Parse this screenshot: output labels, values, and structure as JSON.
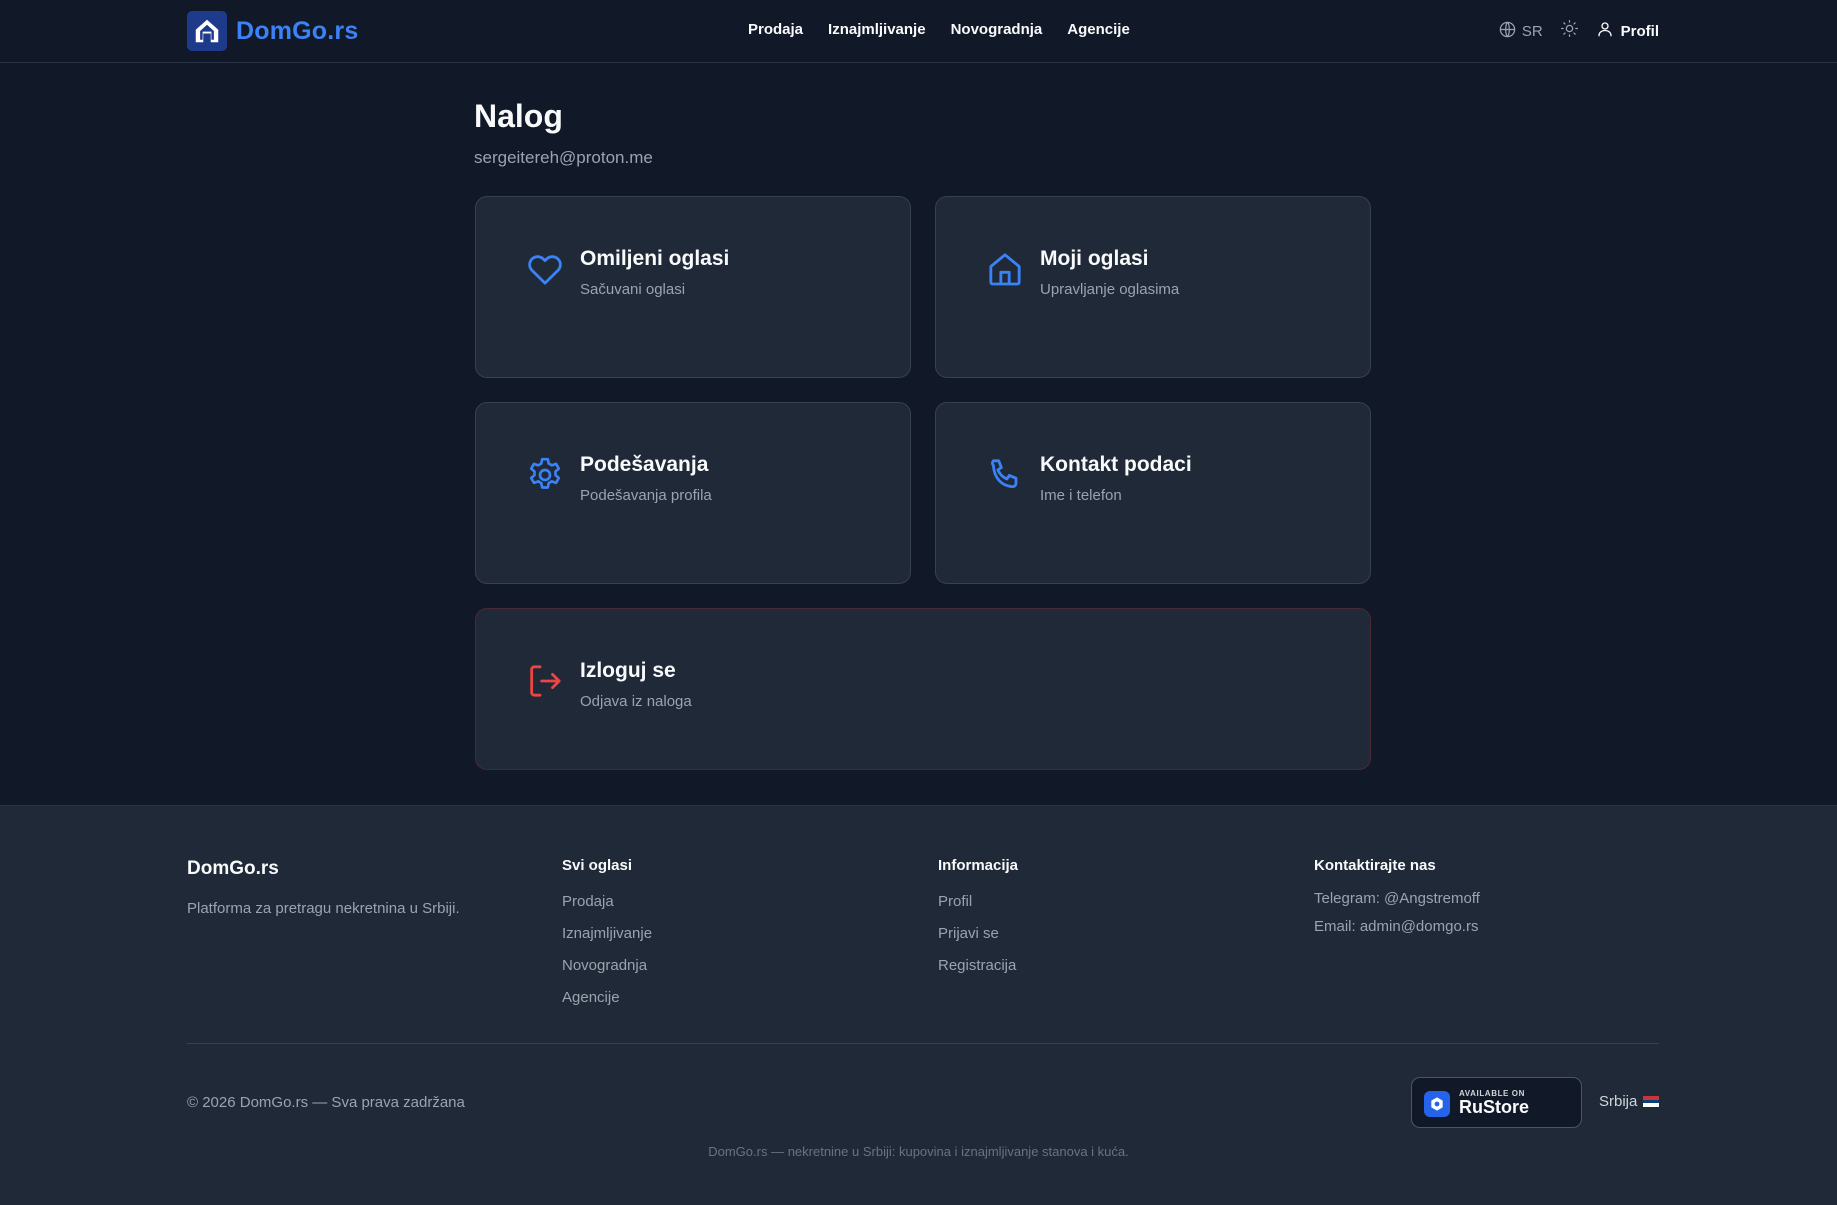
{
  "header": {
    "logo_text": "DomGo.rs",
    "nav": [
      "Prodaja",
      "Iznajmljivanje",
      "Novogradnja",
      "Agencije"
    ],
    "language": "SR",
    "profile_label": "Profil"
  },
  "main": {
    "title": "Nalog",
    "email": "sergeitereh@proton.me",
    "cards": [
      {
        "title": "Omiljeni oglasi",
        "subtitle": "Sačuvani oglasi",
        "icon": "heart-icon"
      },
      {
        "title": "Moji oglasi",
        "subtitle": "Upravljanje oglasima",
        "icon": "home-icon"
      },
      {
        "title": "Podešavanja",
        "subtitle": "Podešavanja profila",
        "icon": "gear-icon"
      },
      {
        "title": "Kontakt podaci",
        "subtitle": "Ime i telefon",
        "icon": "phone-icon"
      },
      {
        "title": "Izloguj se",
        "subtitle": "Odjava iz naloga",
        "icon": "logout-icon"
      }
    ]
  },
  "footer": {
    "brand": "DomGo.rs",
    "description": "Platforma za pretragu nekretnina u Srbiji.",
    "col_all": {
      "heading": "Svi oglasi",
      "links": [
        "Prodaja",
        "Iznajmljivanje",
        "Novogradnja",
        "Agencije"
      ]
    },
    "col_info": {
      "heading": "Informacija",
      "links": [
        "Profil",
        "Prijavi se",
        "Registracija"
      ]
    },
    "col_contact": {
      "heading": "Kontaktirajte nas",
      "telegram": "Telegram: @Angstremoff",
      "email": "Email: admin@domgo.rs"
    },
    "copyright": "© 2026 DomGo.rs — Sva prava zadržana",
    "rustore_small": "AVAILABLE ON",
    "rustore_big": "RuStore",
    "country": "Srbija",
    "tagline": "DomGo.rs — nekretnine u Srbiji: kupovina i iznajmljivanje stanova i kuća."
  },
  "colors": {
    "background": "#111827",
    "card": "#1f2937",
    "accent": "#3b82f6",
    "danger": "#ef4444"
  }
}
